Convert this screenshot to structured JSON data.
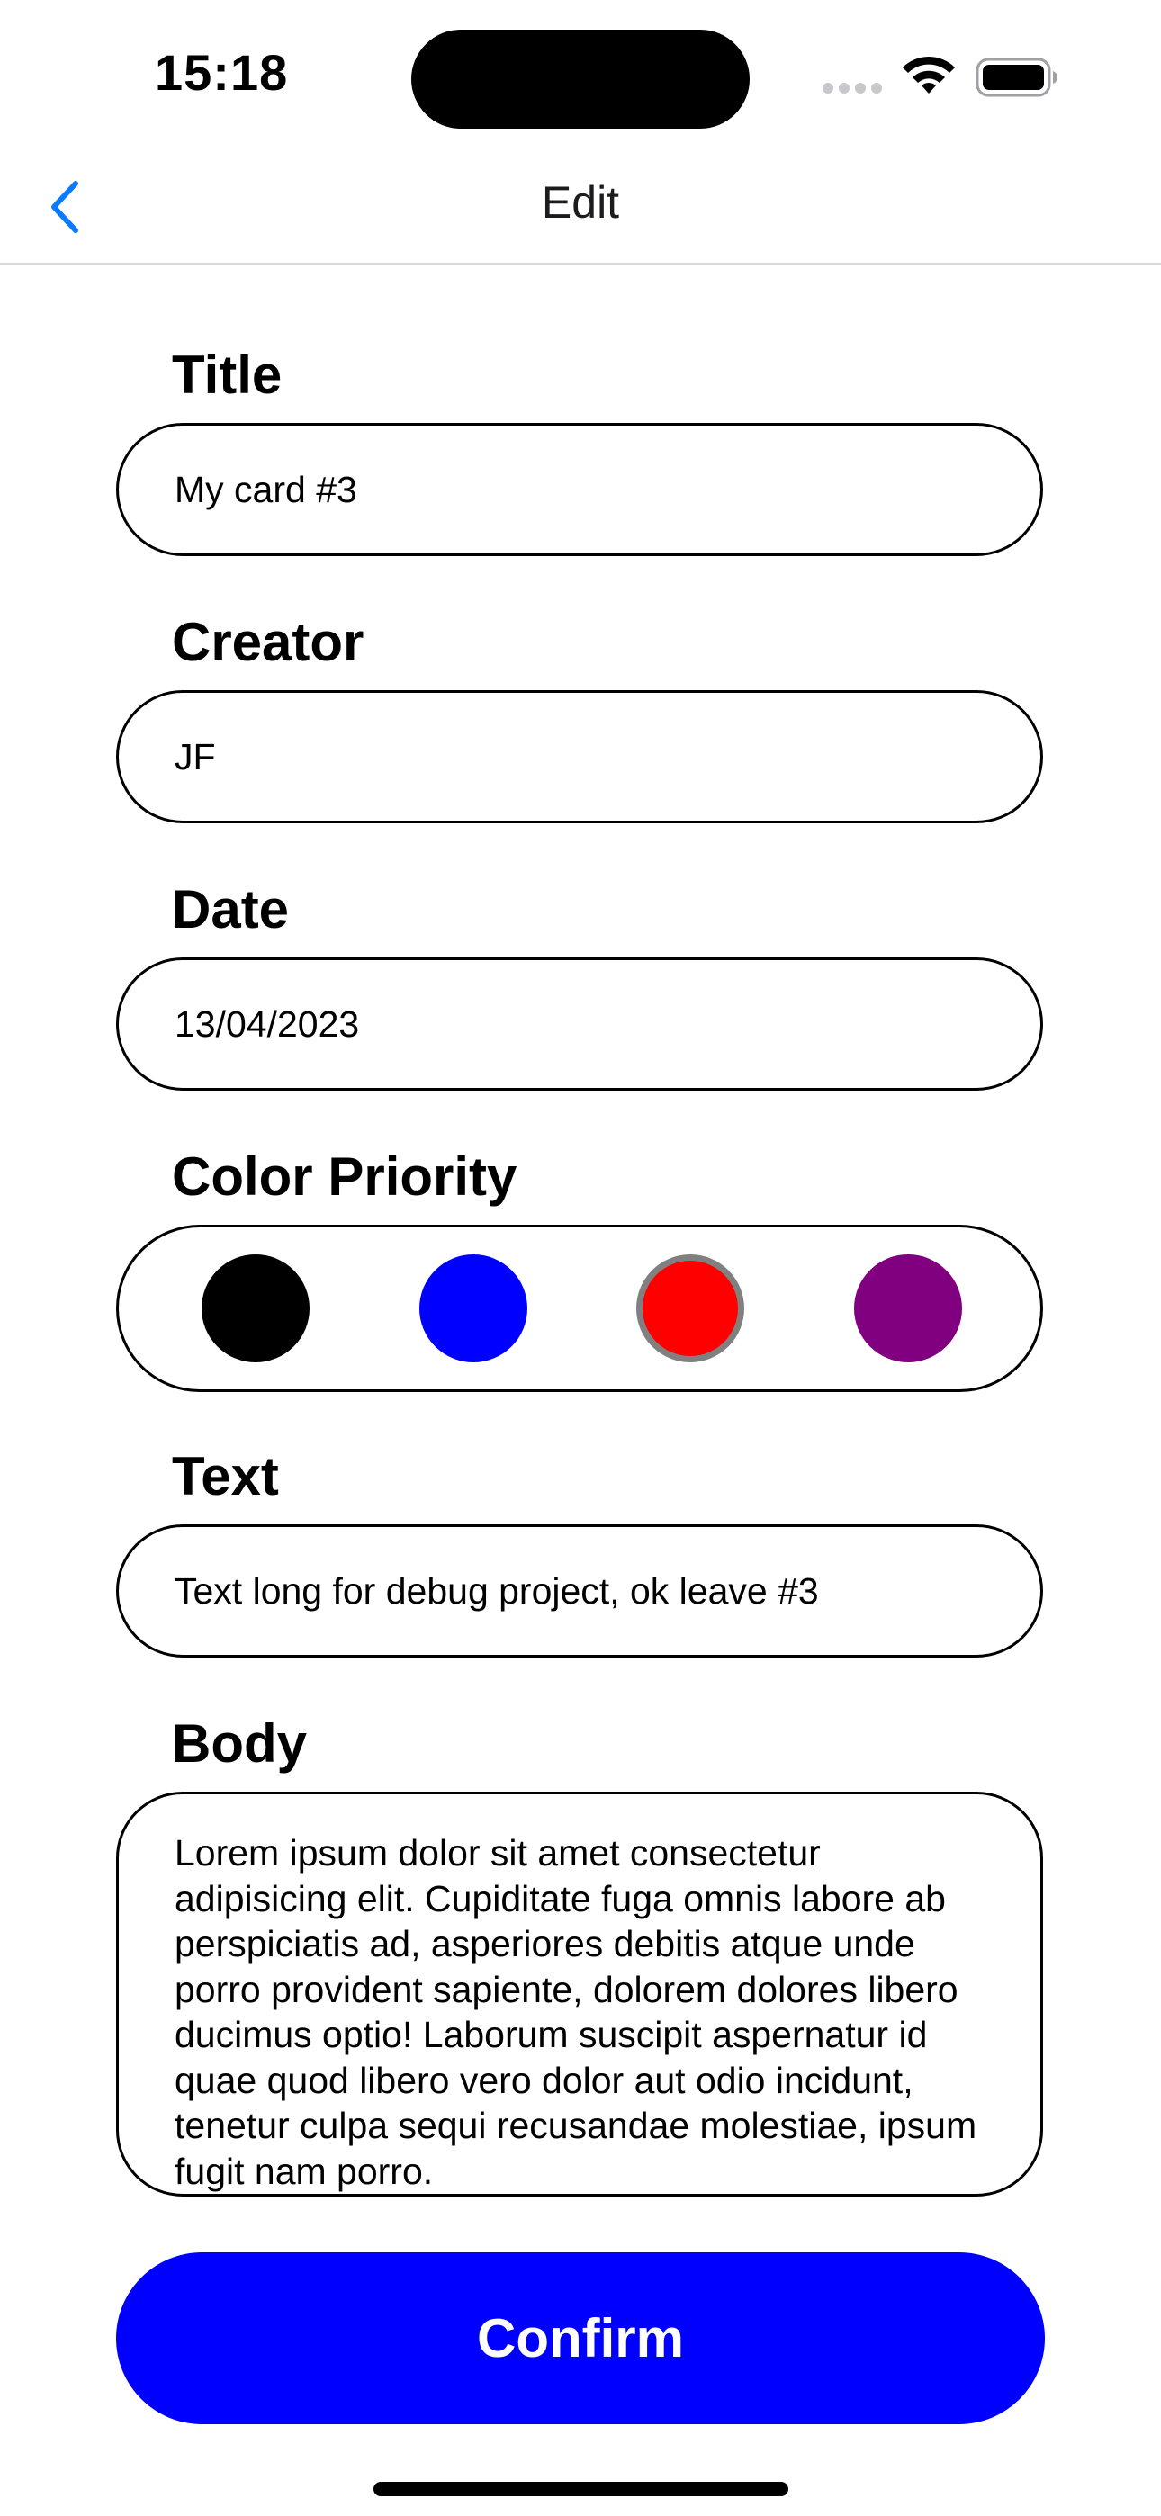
{
  "status_bar": {
    "time": "15:18",
    "icons": [
      "cellular-signal-icon",
      "wifi-icon",
      "battery-icon"
    ]
  },
  "nav": {
    "back_icon": "chevron-left-icon",
    "title": "Edit",
    "accent_color": "#0a7aff"
  },
  "form": {
    "title": {
      "label": "Title",
      "value": "My card #3"
    },
    "creator": {
      "label": "Creator",
      "value": "JF"
    },
    "date": {
      "label": "Date",
      "value": "13/04/2023"
    },
    "color_priority": {
      "label": "Color Priority",
      "options": [
        {
          "name": "black",
          "color": "#000000",
          "selected": false
        },
        {
          "name": "blue",
          "color": "#0000ff",
          "selected": false
        },
        {
          "name": "red",
          "color": "#ff0000",
          "selected": true
        },
        {
          "name": "purple",
          "color": "#800080",
          "selected": false
        }
      ]
    },
    "text": {
      "label": "Text",
      "value": "Text long for debug project, ok leave #3"
    },
    "body": {
      "label": "Body",
      "value": "Lorem ipsum dolor sit amet consectetur adipisicing elit. Cupiditate fuga omnis labore ab perspiciatis ad, asperiores debitis atque unde porro provident sapiente, dolorem dolores libero ducimus optio! Laborum suscipit aspernatur id quae quod libero vero dolor aut odio incidunt, tenetur culpa sequi recusandae molestiae, ipsum fugit nam porro."
    }
  },
  "confirm_button": {
    "label": "Confirm",
    "color": "#0000ff"
  }
}
